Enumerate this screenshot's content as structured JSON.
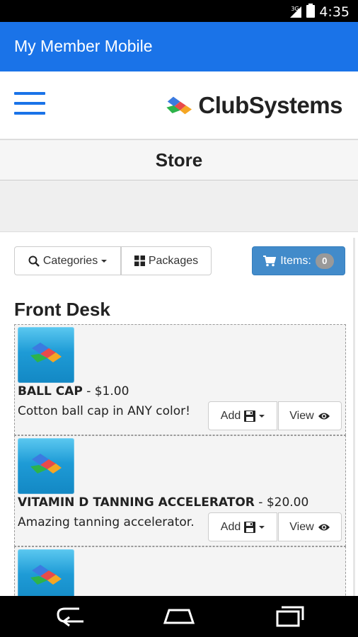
{
  "status_bar": {
    "time": "4:35",
    "network": "3G",
    "icons": [
      "signal-icon",
      "battery-icon"
    ]
  },
  "app_bar": {
    "title": "My Member Mobile",
    "color": "#1a73e8"
  },
  "header": {
    "menu_icon": "hamburger-menu-icon",
    "brand_name": "ClubSystems"
  },
  "store": {
    "title": "Store"
  },
  "toolbar": {
    "categories_label": "Categories",
    "packages_label": "Packages",
    "items_label": "Items:",
    "items_count": "0",
    "items_color": "#428bca"
  },
  "section": {
    "title": "Front Desk"
  },
  "products": [
    {
      "name": "BALL CAP",
      "price": " - $1.00",
      "description": "Cotton ball cap in ANY color!",
      "add_label": "Add",
      "view_label": "View"
    },
    {
      "name": "VITAMIN D TANNING ACCELERATOR",
      "price": " - $20.00",
      "description": "Amazing tanning accelerator.",
      "add_label": "Add",
      "view_label": "View"
    }
  ],
  "nav": {
    "icons": [
      "back-icon",
      "home-icon",
      "recents-icon"
    ]
  }
}
